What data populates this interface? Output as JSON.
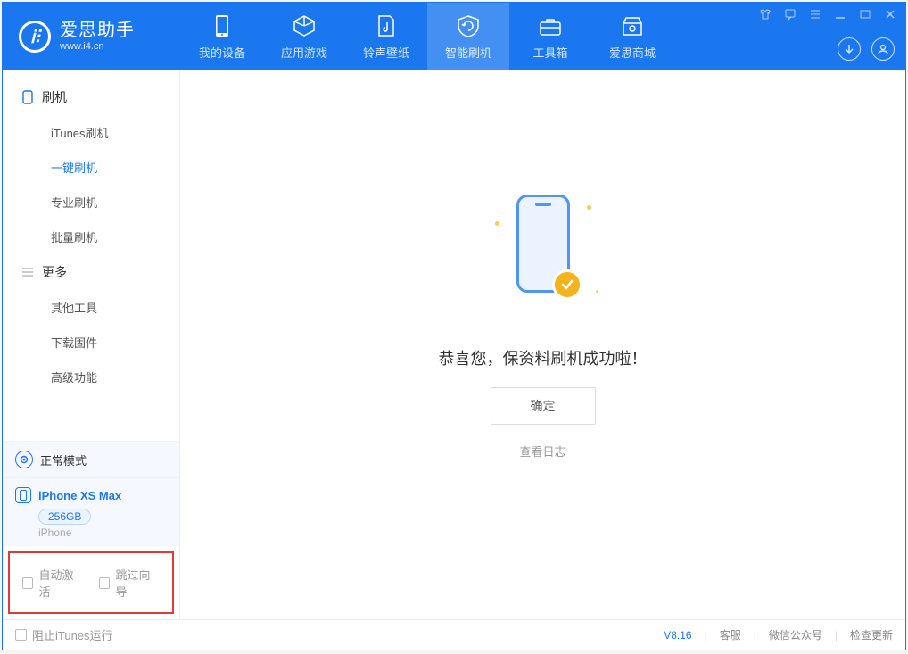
{
  "app": {
    "title": "爱思助手",
    "subtitle": "www.i4.cn"
  },
  "nav": {
    "items": [
      {
        "id": "device",
        "label": "我的设备"
      },
      {
        "id": "apps",
        "label": "应用游戏"
      },
      {
        "id": "ringtones",
        "label": "铃声壁纸"
      },
      {
        "id": "flash",
        "label": "智能刷机",
        "active": true
      },
      {
        "id": "toolbox",
        "label": "工具箱"
      },
      {
        "id": "store",
        "label": "爱思商城"
      }
    ]
  },
  "sidebar": {
    "group1": {
      "title": "刷机",
      "items": [
        {
          "id": "itunes",
          "label": "iTunes刷机"
        },
        {
          "id": "oneclick",
          "label": "一键刷机",
          "active": true
        },
        {
          "id": "pro",
          "label": "专业刷机"
        },
        {
          "id": "batch",
          "label": "批量刷机"
        }
      ]
    },
    "group2": {
      "title": "更多",
      "items": [
        {
          "id": "other",
          "label": "其他工具"
        },
        {
          "id": "firmware",
          "label": "下载固件"
        },
        {
          "id": "advanced",
          "label": "高级功能"
        }
      ]
    },
    "mode": {
      "label": "正常模式"
    },
    "device": {
      "name": "iPhone XS Max",
      "storage": "256GB",
      "type": "iPhone"
    },
    "options": {
      "auto_activate": "自动激活",
      "skip_guide": "跳过向导"
    }
  },
  "main": {
    "success_message": "恭喜您，保资料刷机成功啦！",
    "ok_label": "确定",
    "view_log_label": "查看日志"
  },
  "status": {
    "block_itunes": "阻止iTunes运行",
    "version": "V8.16",
    "support": "客服",
    "wechat": "微信公众号",
    "update": "检查更新"
  }
}
